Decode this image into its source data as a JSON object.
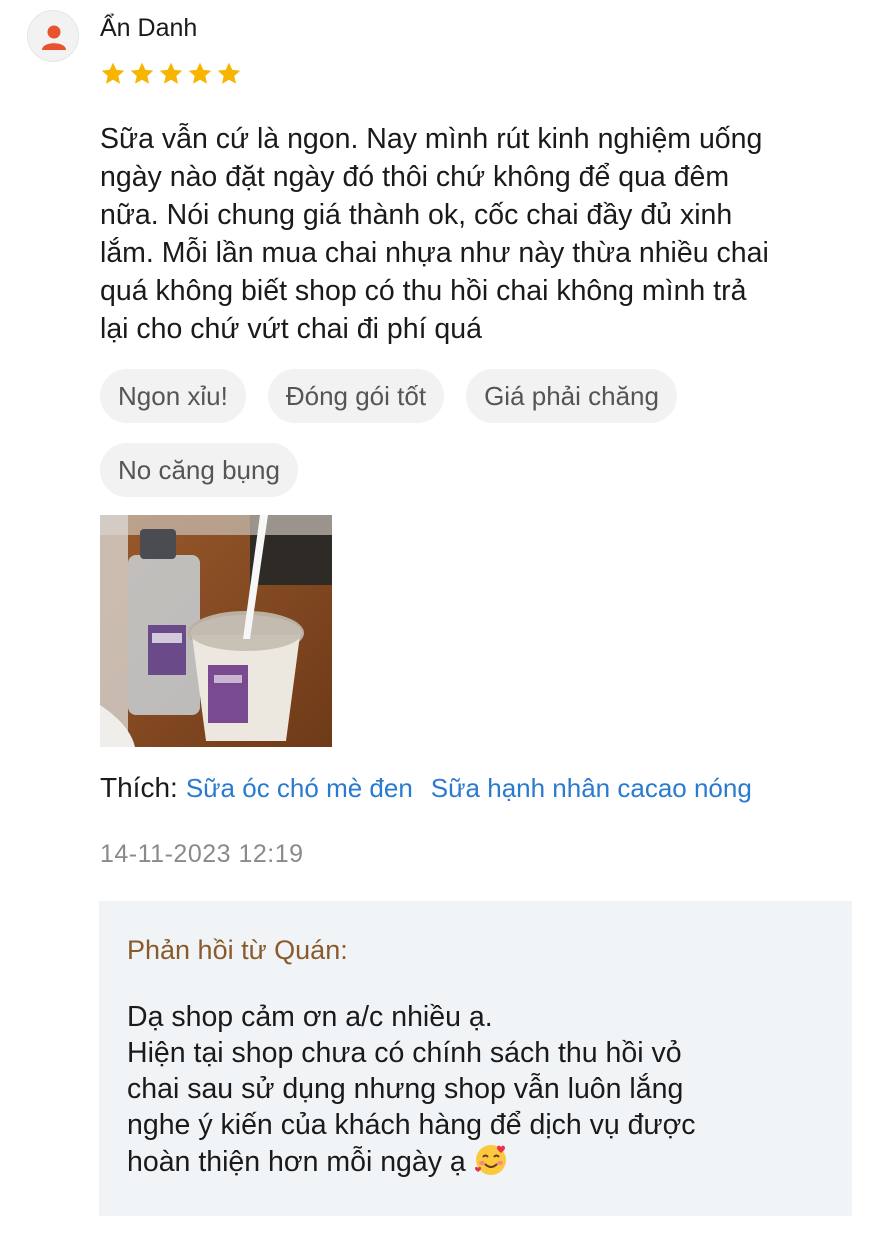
{
  "review": {
    "username": "Ẩn Danh",
    "rating": 5,
    "rating_color": "#f7b500",
    "text": "Sữa vẫn cứ là ngon. Nay mình rút kinh nghiệm uống\nngày nào đặt ngày đó thôi chứ không để qua đêm\nnữa. Nói chung giá thành ok, cốc chai đầy đủ xinh\nlắm. Mỗi lần mua chai nhựa như này thừa nhiều chai\nquá không biết shop có thu hồi chai không mình trả\nlại cho chứ vứt chai đi phí quá",
    "tags": [
      "Ngon xỉu!",
      "Đóng gói tốt",
      "Giá phải chăng",
      "No căng bụng"
    ],
    "likes_label": "Thích:",
    "liked_items": [
      "Sữa óc chó mè đen",
      "Sữa hạnh nhân cacao nóng"
    ],
    "timestamp": "14-11-2023 12:19"
  },
  "reply": {
    "title": "Phản hồi từ Quán:",
    "text": "Dạ shop cảm ơn a/c nhiều ạ.\nHiện tại shop chưa có chính sách thu hồi vỏ\nchai sau sử dụng nhưng shop vẫn luôn lắng\nnghe ý kiến của khách hàng để dịch vụ được\nhoàn thiện hơn mỗi ngày ạ",
    "emoji": "smiling-face-with-hearts-icon"
  },
  "colors": {
    "link": "#2a7ad0",
    "reply_title": "#8a5a2b",
    "avatar_icon": "#e8522f",
    "reply_bg": "#f1f4f7"
  }
}
